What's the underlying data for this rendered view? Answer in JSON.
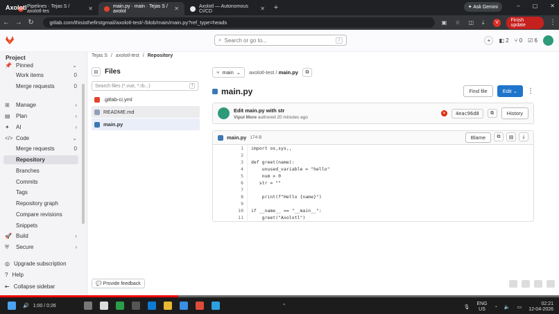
{
  "browser": {
    "brand": "Axolotl",
    "tabs": [
      {
        "label": "Pipelines · Tejas S / axolotl-tes"
      },
      {
        "label": "main.py · main · Tejas S / axolot"
      },
      {
        "label": "Axolotl — Autonomous CI/CD"
      }
    ],
    "ask_gemini": "Ask Gemini",
    "url": "gitlab.com/thisisthefirstgmail/axolotl-test/-/blob/main/main.py?ref_type=heads",
    "finish_update": "Finish update",
    "profile_letter": "V"
  },
  "header": {
    "search_placeholder": "Search or go to...",
    "search_shortcut": "/",
    "issues_count": "2",
    "mr_count": "0",
    "todo_count": "6"
  },
  "sidebar": {
    "project_label": "Project",
    "items": [
      {
        "label": "Pinned",
        "count": ""
      },
      {
        "label": "Work items",
        "count": "0"
      },
      {
        "label": "Merge requests",
        "count": "0"
      },
      {
        "label": "Manage"
      },
      {
        "label": "Plan"
      },
      {
        "label": "AI"
      },
      {
        "label": "Code"
      },
      {
        "label": "Merge requests",
        "count": "0"
      },
      {
        "label": "Repository"
      },
      {
        "label": "Branches"
      },
      {
        "label": "Commits"
      },
      {
        "label": "Tags"
      },
      {
        "label": "Repository graph"
      },
      {
        "label": "Compare revisions"
      },
      {
        "label": "Snippets"
      },
      {
        "label": "Build"
      },
      {
        "label": "Secure"
      }
    ],
    "upgrade": "Upgrade subscription",
    "help": "Help",
    "collapse": "Collapse sidebar"
  },
  "breadcrumb": [
    "Tejas S",
    "axolotl-test",
    "Repository"
  ],
  "files": {
    "title": "Files",
    "search_placeholder": "Search files (*.vue, *.rb...)",
    "shortcut": "f",
    "items": [
      ".gitlab-ci.yml",
      "README.md",
      "main.py"
    ]
  },
  "file": {
    "branch": "main",
    "repo": "axolotl-test",
    "path_file": "main.py",
    "title": "main.py",
    "find_file": "Find file",
    "edit": "Edit",
    "commit_message": "Edit main.py with str",
    "commit_author": "Vipul More",
    "commit_meta": "authored 20 minutes ago",
    "sha": "4eac96d8",
    "history": "History",
    "blob_name": "main.py",
    "blob_size": "174 B",
    "blame": "Blame",
    "code_lines": [
      "import os,sys,,",
      "",
      "def greet(name):",
      "    unused_variable = \"hello\"",
      "    num = 0",
      "   str = \"\"",
      "",
      "    print(f\"Hello {name}\")",
      "",
      "if __name__ == \"__main__\":",
      "    greet(\"Axolotl\")"
    ]
  },
  "feedback": "Provide feedback",
  "taskbar": {
    "lang": "ENG",
    "region": "US",
    "time": "02:21",
    "date": "12-04-2026",
    "video_time": "1:00 / 0:26"
  },
  "colors": {
    "primary": "#1f75cb",
    "fail": "#dd2b0e",
    "sidebar_bg": "#f4f4f6"
  }
}
